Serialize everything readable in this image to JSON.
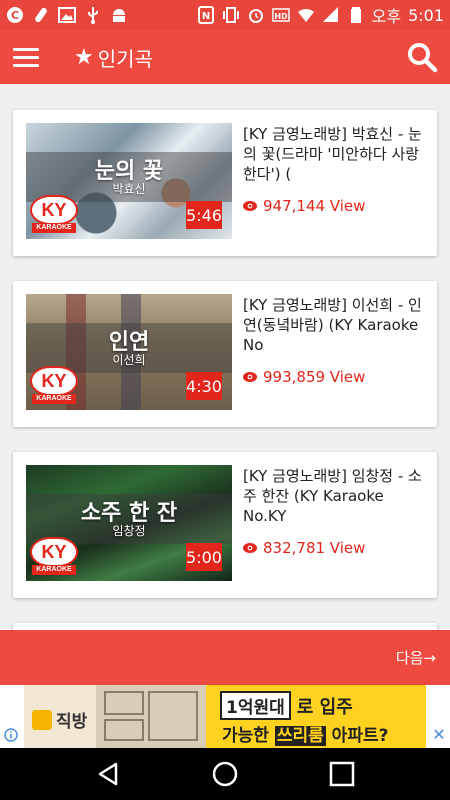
{
  "status_bar": {
    "carrier_ampm": "오후",
    "time": "5:01",
    "icons": [
      "c-icon",
      "cleaner-icon",
      "image-icon",
      "usb-icon",
      "android-icon",
      "nfc-icon",
      "vibrate-icon",
      "alarm-icon",
      "hd-icon",
      "wifi-icon",
      "signal-icon",
      "battery-icon"
    ]
  },
  "app_bar": {
    "title": "인기곡",
    "star": "★",
    "icons": {
      "menu": "hamburger-menu-icon",
      "search": "search-icon"
    }
  },
  "songs": [
    {
      "thumb_title": "눈의 꽃",
      "thumb_singer": "박효신",
      "duration": "5:46",
      "title": "[KY 금영노래방] 박효신 - 눈의 꽃(드라마 '미안하다 사랑한다') (",
      "views": "947,144 View"
    },
    {
      "thumb_title": "인연",
      "thumb_singer": "이선희",
      "duration": "4:30",
      "title": "[KY 금영노래방] 이선희 - 인연(동녘바람) (KY Karaoke No",
      "views": "993,859 View"
    },
    {
      "thumb_title": "소주 한 잔",
      "thumb_singer": "임창정",
      "duration": "5:00",
      "title": "[KY 금영노래방] 임창정 - 소주 한잔 (KY Karaoke No.KY",
      "views": "832,781 View"
    }
  ],
  "logo": {
    "ky": "KY",
    "karaoke": "KARAOKE"
  },
  "next": {
    "label": "다음→"
  },
  "ad": {
    "left_brand": "직방",
    "chip": "1억원대",
    "line1_rest": "로 입주",
    "line2_a": "가능한 ",
    "line2_hl": "쓰리룸",
    "line2_b": " 아파트?",
    "close": "✕"
  },
  "colors": {
    "primary": "#ee4a40",
    "accent_red": "#e2261c"
  }
}
